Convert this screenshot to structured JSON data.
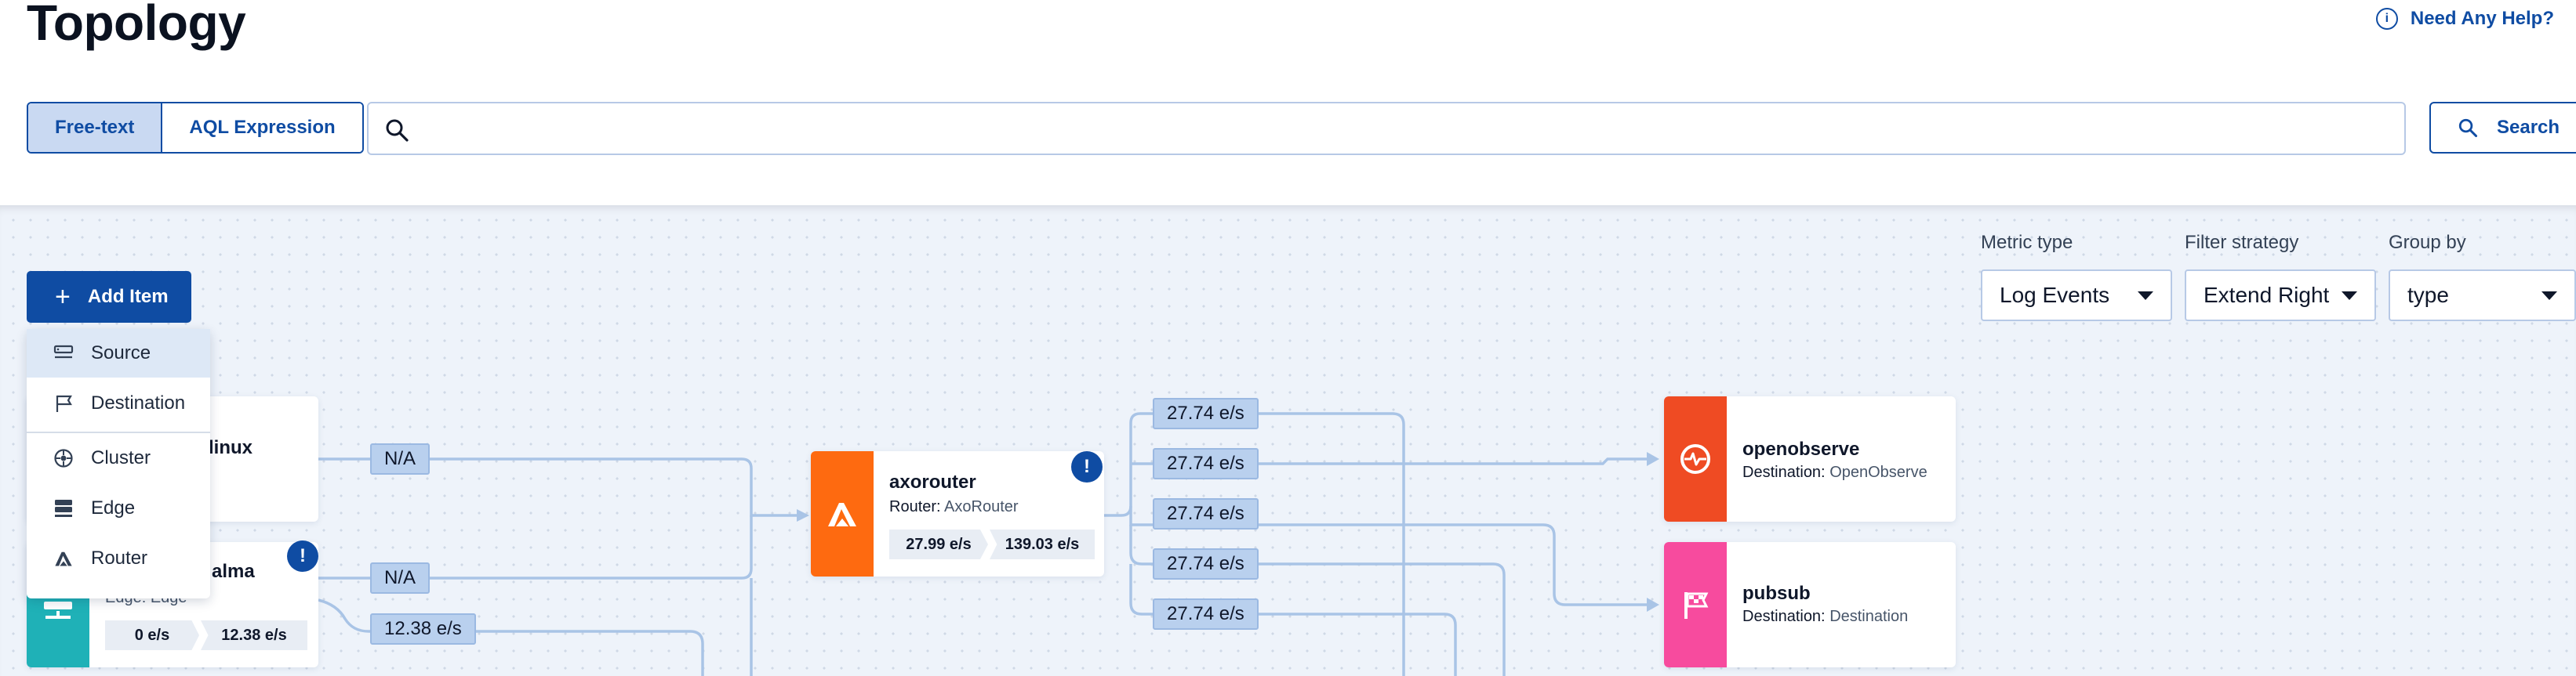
{
  "page": {
    "title": "Topology",
    "help_label": "Need Any Help?",
    "help_glyph": "i"
  },
  "search": {
    "modes": [
      "Free-text",
      "AQL Expression"
    ],
    "active_mode": "Free-text",
    "placeholder": "",
    "button_label": "Search"
  },
  "toolbar": {
    "add_item_label": "Add Item",
    "add_menu": [
      {
        "label": "Source",
        "icon": "source-icon"
      },
      {
        "label": "Destination",
        "icon": "flag-icon"
      },
      {
        "label": "Cluster",
        "icon": "cluster-icon"
      },
      {
        "label": "Edge",
        "icon": "edge-icon"
      },
      {
        "label": "Router",
        "icon": "router-icon"
      }
    ]
  },
  "controls": {
    "metric_type": {
      "label": "Metric type",
      "value": "Log Events"
    },
    "filter_strategy": {
      "label": "Filter strategy",
      "value": "Extend Right"
    },
    "group_by": {
      "label": "Group by",
      "value": "type"
    }
  },
  "nodes": {
    "linux": {
      "name": "linux",
      "icon": "source-icon"
    },
    "alma": {
      "name": "alma",
      "subtitle": "Edge: Edge",
      "in_rate": "0 e/s",
      "out_rate": "12.38 e/s",
      "alert": "!",
      "accent": "#1fb1b7"
    },
    "axorouter": {
      "name": "axorouter",
      "type_label": "Router:",
      "type_value": "AxoRouter",
      "in_rate": "27.99 e/s",
      "out_rate": "139.03 e/s",
      "alert": "!",
      "accent": "#fe6a10"
    },
    "openobserve": {
      "name": "openobserve",
      "type_label": "Destination:",
      "type_value": "OpenObserve",
      "accent": "#ef4b23"
    },
    "pubsub": {
      "name": "pubsub",
      "type_label": "Destination:",
      "type_value": "Destination",
      "accent": "#f74b9e"
    }
  },
  "edge_rates": {
    "linux_to_router": "N/A",
    "alma_to_router": "N/A",
    "alma_out": "12.38 e/s",
    "router_out": [
      "27.74 e/s",
      "27.74 e/s",
      "27.74 e/s",
      "27.74 e/s",
      "27.74 e/s"
    ]
  },
  "colors": {
    "primary": "#0f4ca3",
    "edge": "#a9c4e6",
    "canvas": "#eef3fa"
  }
}
